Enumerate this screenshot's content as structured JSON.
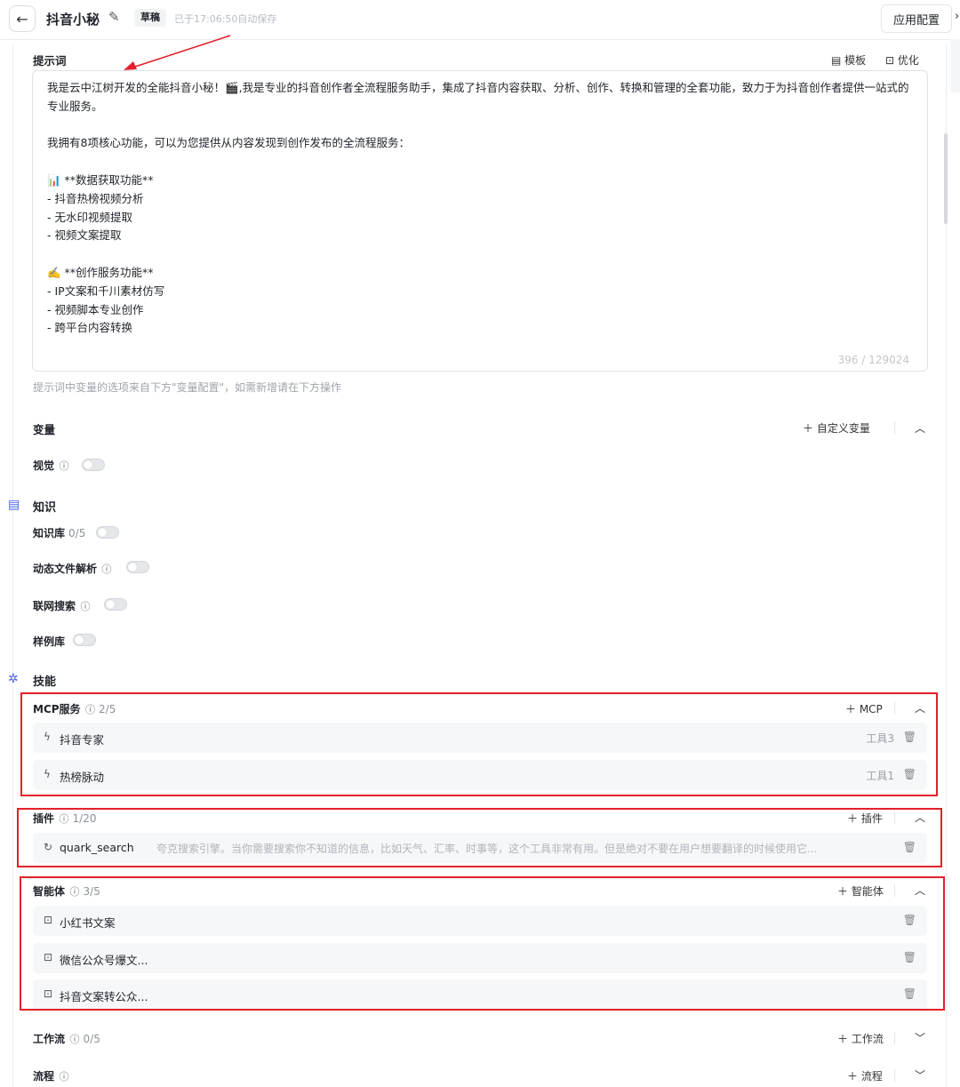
{
  "header": {
    "title": "抖音小秘",
    "draft_badge": "草稿",
    "save_status": "已于17:06:50自动保存",
    "config_button": "应用配置"
  },
  "prompt": {
    "label": "提示词",
    "template_button": "模板",
    "optimize_button": "优化",
    "text": "我是云中江树开发的全能抖音小秘！🎬,我是专业的抖音创作者全流程服务助手，集成了抖音内容获取、分析、创作、转换和管理的全套功能，致力于为抖音创作者提供一站式的专业服务。\n\n我拥有8项核心功能，可以为您提供从内容发现到创作发布的全流程服务：\n\n📊 **数据获取功能**\n- 抖音热榜视频分析\n- 无水印视频提取\n- 视频文案提取\n\n✍️ **创作服务功能**\n- IP文案和千川素材仿写\n- 视频脚本专业创作\n- 跨平台内容转换",
    "char_count": "396 / 129024",
    "hint": "提示词中变量的选项来自下方\"变量配置\"，如需新增请在下方操作"
  },
  "variables": {
    "label": "变量",
    "add_button": "自定义变量",
    "vision_label": "视觉",
    "vision_enabled": false
  },
  "knowledge": {
    "heading": "知识",
    "kb_label": "知识库",
    "kb_count": "0/5",
    "dynamic_parse_label": "动态文件解析",
    "web_search_label": "联网搜索",
    "examples_label": "样例库"
  },
  "skills": {
    "heading": "技能",
    "mcp": {
      "label": "MCP服务",
      "count": "2/5",
      "add_button": "MCP",
      "items": [
        {
          "name": "抖音专家",
          "tag": "工具3"
        },
        {
          "name": "热榜脉动",
          "tag": "工具1"
        }
      ]
    },
    "plugins": {
      "label": "插件",
      "count": "1/20",
      "add_button": "插件",
      "items": [
        {
          "name": "quark_search",
          "desc": "夸克搜索引擎。当你需要搜索你不知道的信息，比如天气、汇率、时事等，这个工具非常有用。但是绝对不要在用户想要翻译的时候使用它..."
        }
      ]
    },
    "agents": {
      "label": "智能体",
      "count": "3/5",
      "add_button": "智能体",
      "items": [
        {
          "name": "小红书文案"
        },
        {
          "name": "微信公众号爆文..."
        },
        {
          "name": "抖音文案转公众..."
        }
      ]
    },
    "workflows": {
      "label": "工作流",
      "count": "0/5",
      "add_button": "工作流"
    },
    "flows": {
      "label": "流程",
      "add_button": "流程"
    }
  },
  "colors": {
    "highlight": "#e3202b",
    "accent": "#4a62e8"
  }
}
